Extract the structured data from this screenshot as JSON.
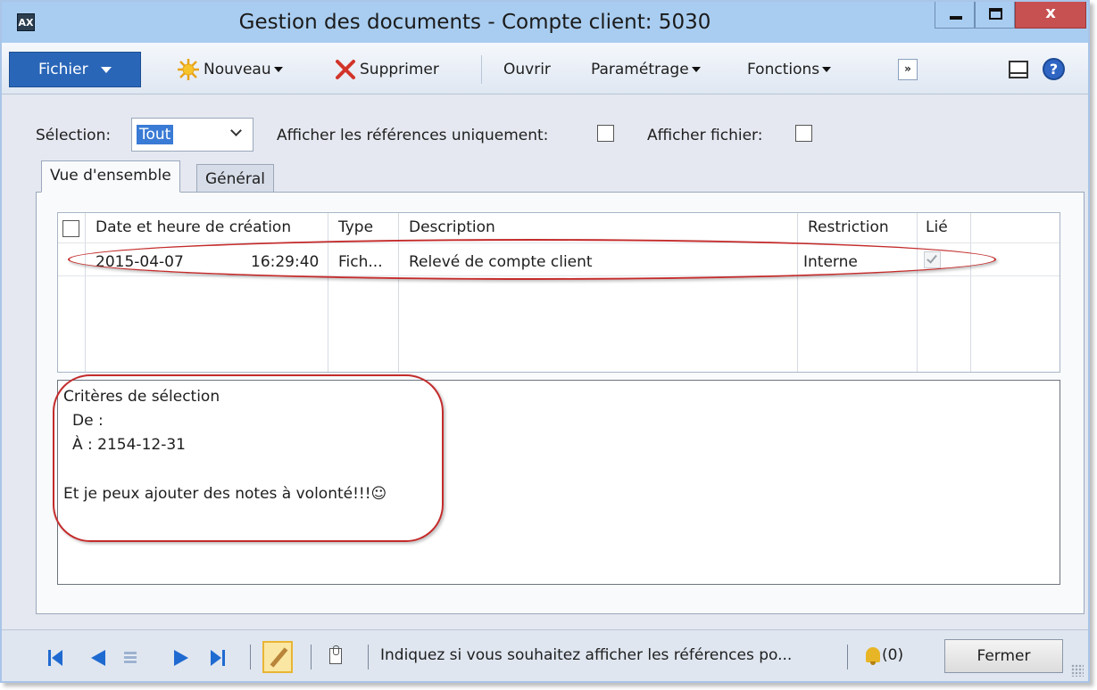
{
  "window": {
    "title": "Gestion des documents - Compte client: 5030",
    "app_icon": "dynamics-ax-icon",
    "close_glyph": "x"
  },
  "toolbar": {
    "file_label": "Fichier",
    "new_label": "Nouveau",
    "delete_label": "Supprimer",
    "open_label": "Ouvrir",
    "setup_label": "Paramétrage",
    "functions_label": "Fonctions",
    "more_glyph": "»",
    "help_glyph": "?"
  },
  "filters": {
    "selection_label": "Sélection:",
    "selection_value": "Tout",
    "show_refs_label": "Afficher les références uniquement:",
    "show_refs_checked": false,
    "show_file_label": "Afficher fichier:",
    "show_file_checked": false
  },
  "tabs": [
    {
      "label": "Vue d'ensemble",
      "active": true
    },
    {
      "label": "Général",
      "active": false
    }
  ],
  "grid": {
    "columns": [
      "Date et heure de création",
      "Type",
      "Description",
      "Restriction",
      "Lié"
    ],
    "rows": [
      {
        "date": "2015-04-07",
        "time": "16:29:40",
        "type": "Fich...",
        "description": "Relevé de compte client",
        "restriction": "Interne",
        "linked": true
      }
    ]
  },
  "notes": {
    "title": "Critères de sélection",
    "from_line": "De :",
    "to_line": "À  : 2154-12-31",
    "comment": "Et je peux ajouter des notes à volonté!!!☺"
  },
  "statusbar": {
    "help_text": "Indiquez si vous souhaitez afficher les références po...",
    "alerts_count": "(0)",
    "close_label": "Fermer"
  },
  "colors": {
    "titlebar": "#a9cdf0",
    "file_button": "#2a66b8",
    "annotation_red": "#c42b2b",
    "close_button": "#c75050"
  }
}
